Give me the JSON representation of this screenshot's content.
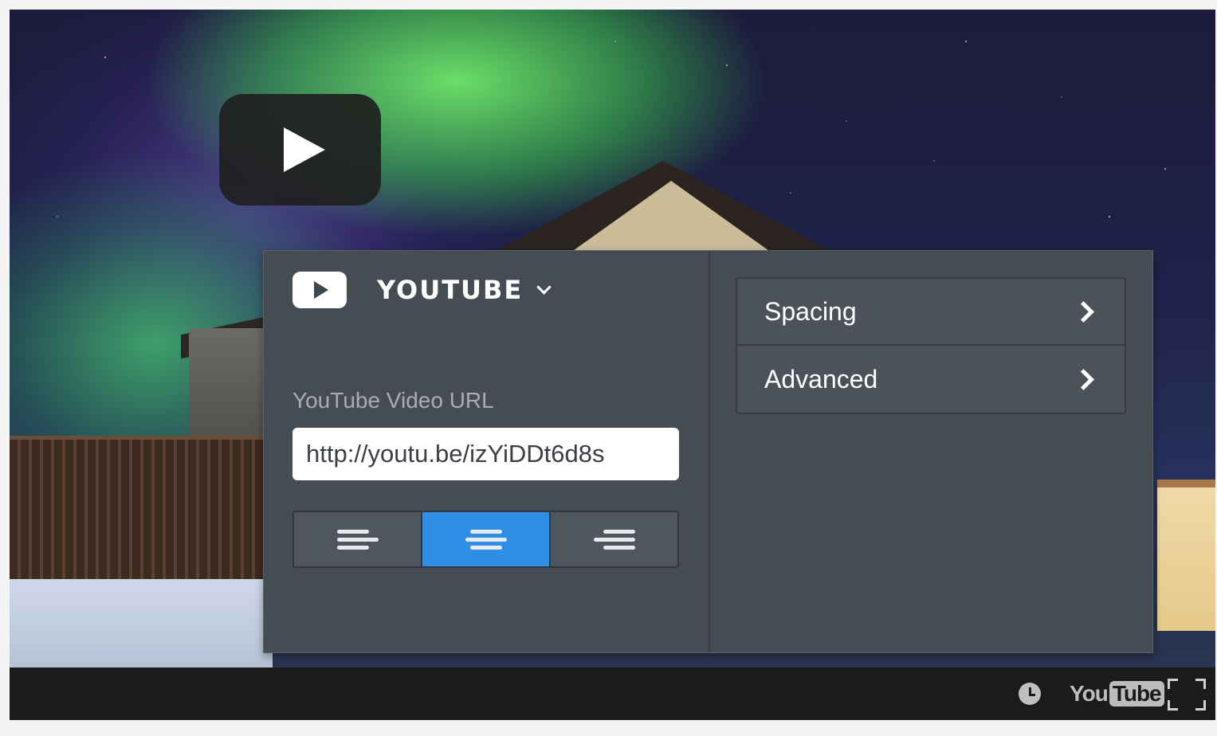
{
  "colors": {
    "panel_bg": "#464c53",
    "accent": "#2f8fe6",
    "control_bar": "#1b1b1b"
  },
  "player": {
    "play_icon": "play-icon",
    "controls": {
      "watch_later_icon": "clock-icon",
      "logo_you": "You",
      "logo_tube": "Tube",
      "fullscreen_icon": "fullscreen-icon"
    }
  },
  "block_editor": {
    "block_type": {
      "icon": "youtube-icon",
      "title": "YOUTUBE",
      "dropdown_icon": "chevron-down-icon"
    },
    "url_field": {
      "label": "YouTube Video URL",
      "value": "http://youtu.be/izYiDDt6d8s"
    },
    "alignment": {
      "options": [
        "left",
        "center",
        "right"
      ],
      "selected": "center"
    },
    "sections": [
      {
        "label": "Spacing",
        "icon": "chevron-right-icon"
      },
      {
        "label": "Advanced",
        "icon": "chevron-right-icon"
      }
    ]
  }
}
